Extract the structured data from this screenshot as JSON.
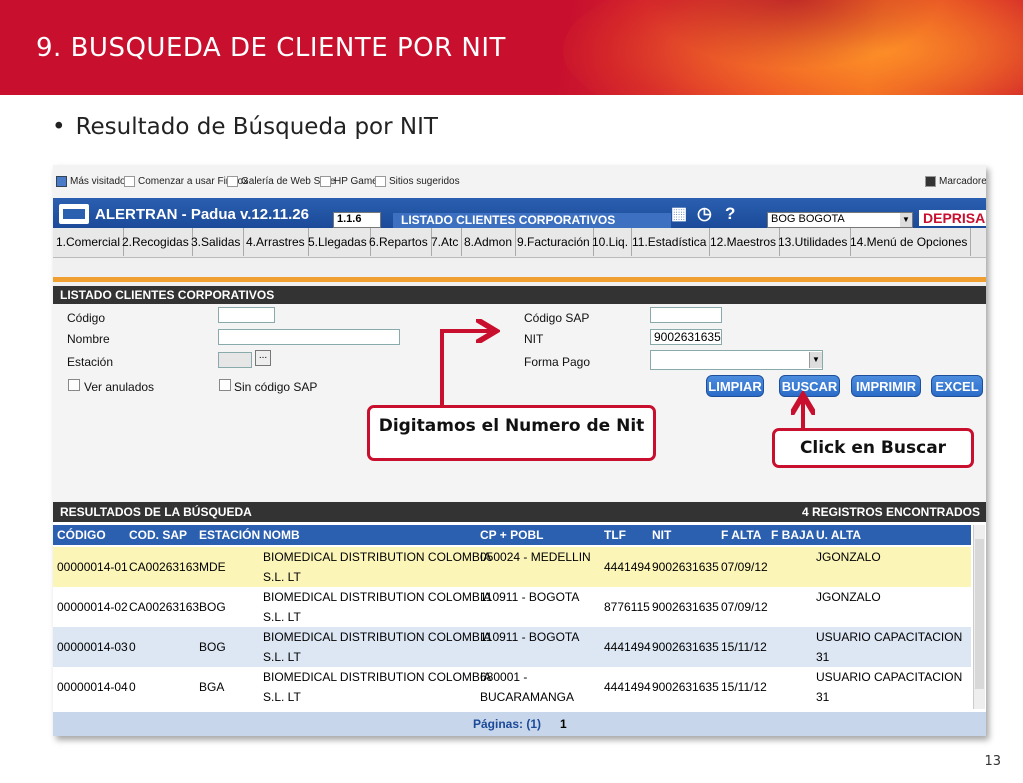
{
  "slide": {
    "title": "9.  BUSQUEDA DE CLIENTE POR NIT",
    "bullet_symbol": "•",
    "bullet": "Resultado de  Búsqueda por  NIT",
    "page_number": "13"
  },
  "browser": {
    "bookmarks": [
      "Más visitados",
      "Comenzar a usar Firefox",
      "Galería de Web Slice",
      "HP Games",
      "Sitios sugeridos"
    ],
    "bookmarks_right": "Marcadores"
  },
  "app": {
    "title": "ALERTRAN - Padua  v.12.11.26",
    "version_box": "1.1.6",
    "window_tab": "LISTADO CLIENTES CORPORATIVOS",
    "branch_select": "BOG BOGOTA",
    "brand": "DEPRISA",
    "help_icon": "?",
    "menu": [
      "1.Comercial",
      "2.Recogidas",
      "3.Salidas",
      "4.Arrastres",
      "5.Llegadas",
      "6.Repartos",
      "7.Atc",
      "8.Admon",
      "9.Facturación",
      "10.Liq.",
      "11.Estadística",
      "12.Maestros",
      "13.Utilidades",
      "14.Menú de Opciones"
    ]
  },
  "form": {
    "panel_title": "LISTADO CLIENTES CORPORATIVOS",
    "codigo_label": "Código",
    "codigo_value": "",
    "nombre_label": "Nombre",
    "nombre_value": "",
    "estacion_label": "Estación",
    "estacion_value": "",
    "estacion_browse": "...",
    "ver_anulados_label": "Ver anulados",
    "sin_codigo_sap_label": "Sin código SAP",
    "codigo_sap_label": "Código SAP",
    "codigo_sap_value": "",
    "nit_label": "NIT",
    "nit_value": "9002631635",
    "forma_pago_label": "Forma Pago",
    "forma_pago_value": "",
    "buttons": {
      "limpiar": "LIMPIAR",
      "buscar": "BUSCAR",
      "imprimir": "IMPRIMIR",
      "excel": "EXCEL"
    }
  },
  "callouts": {
    "nit": "Digitamos el Numero de Nit",
    "buscar": "Click en Buscar"
  },
  "results": {
    "title": "RESULTADOS DE LA BÚSQUEDA",
    "count_label": "4  REGISTROS ENCONTRADOS",
    "columns": [
      "CÓDIGO",
      "COD. SAP",
      "ESTACIÓN",
      "NOMB",
      "CP + POBL",
      "TLF",
      "NIT",
      "F ALTA",
      "F BAJA",
      "U. ALTA"
    ],
    "rows": [
      {
        "codigo": "00000014-01",
        "cod_sap": "CA00263163",
        "estacion": "MDE",
        "nomb_1": "BIOMEDICAL DISTRIBUTION COLOMBIA",
        "nomb_2": "S.L. LT",
        "pobl_1": "050024 - MEDELLIN",
        "pobl_2": "",
        "tlf": "4441494",
        "nit": "9002631635",
        "f_alta": "07/09/12",
        "f_baja": "",
        "u_alta_1": "JGONZALO",
        "u_alta_2": ""
      },
      {
        "codigo": "00000014-02",
        "cod_sap": "CA00263163",
        "estacion": "BOG",
        "nomb_1": "BIOMEDICAL DISTRIBUTION COLOMBIA",
        "nomb_2": "S.L. LT",
        "pobl_1": "110911 - BOGOTA",
        "pobl_2": "",
        "tlf": "8776115",
        "nit": "9002631635",
        "f_alta": "07/09/12",
        "f_baja": "",
        "u_alta_1": "JGONZALO",
        "u_alta_2": ""
      },
      {
        "codigo": "00000014-03",
        "cod_sap": "0",
        "estacion": "BOG",
        "nomb_1": "BIOMEDICAL DISTRIBUTION COLOMBIA",
        "nomb_2": "S.L. LT",
        "pobl_1": "110911 - BOGOTA",
        "pobl_2": "",
        "tlf": "4441494",
        "nit": "9002631635",
        "f_alta": "15/11/12",
        "f_baja": "",
        "u_alta_1": "USUARIO CAPACITACION",
        "u_alta_2": "31"
      },
      {
        "codigo": "00000014-04",
        "cod_sap": "0",
        "estacion": "BGA",
        "nomb_1": "BIOMEDICAL DISTRIBUTION COLOMBIA",
        "nomb_2": "S.L. LT",
        "pobl_1": "680001 -",
        "pobl_2": "BUCARAMANGA",
        "tlf": "4441494",
        "nit": "9002631635",
        "f_alta": "15/11/12",
        "f_baja": "",
        "u_alta_1": "USUARIO CAPACITACION",
        "u_alta_2": "31"
      }
    ],
    "pager_label": "Páginas: (1)",
    "pager_current": "1"
  },
  "colors": {
    "slide_red": "#c8102e",
    "app_blue": "#2b5fb0",
    "highlight_row": "#fbf5b8",
    "alt_row": "#dde6f3",
    "callout_border": "#c8102e"
  }
}
